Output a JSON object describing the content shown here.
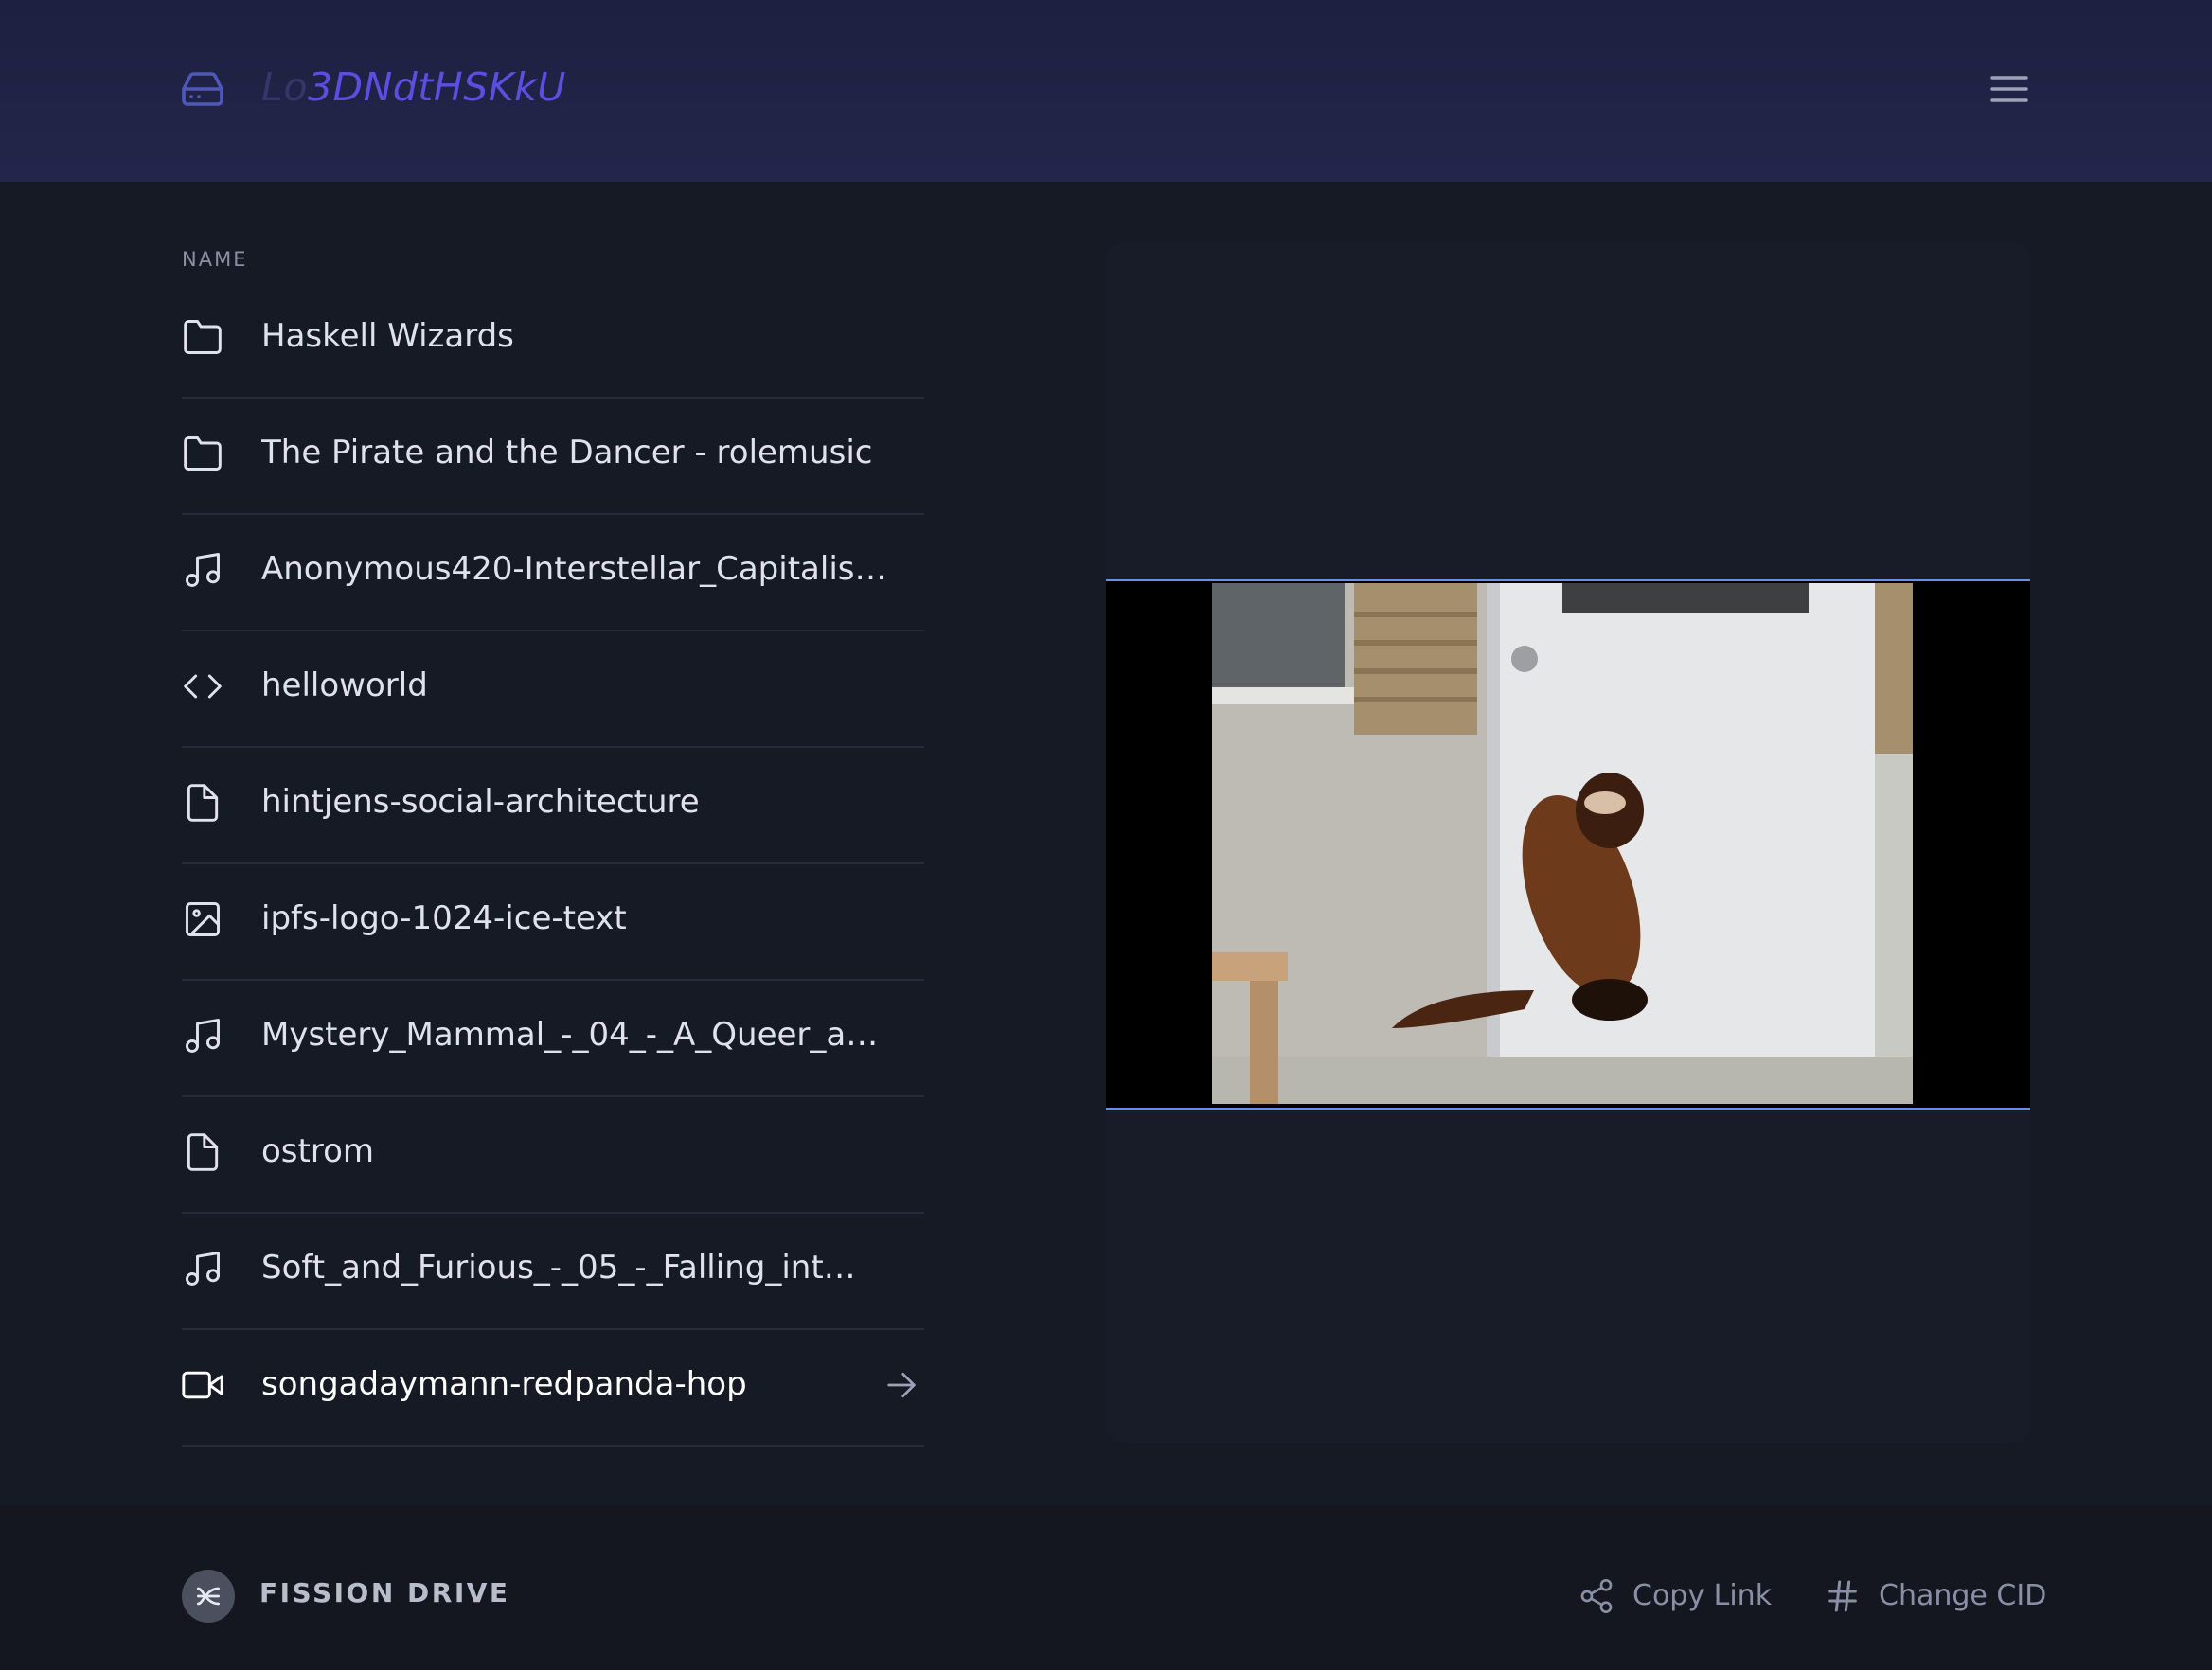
{
  "header": {
    "cid_faded": "Lo",
    "cid_main": "3DNdtHSKkU",
    "drive_icon": "hard-drive-icon",
    "menu_icon": "hamburger-menu-icon"
  },
  "list": {
    "column_header": "NAME",
    "items": [
      {
        "label": "Haskell Wizards",
        "icon": "folder-icon"
      },
      {
        "label": "The Pirate and the Dancer - rolemusic",
        "icon": "folder-icon"
      },
      {
        "label": "Anonymous420-Interstellar_Capitalism…",
        "icon": "music-icon"
      },
      {
        "label": "helloworld",
        "icon": "code-icon"
      },
      {
        "label": "hintjens-social-architecture",
        "icon": "file-icon"
      },
      {
        "label": "ipfs-logo-1024-ice-text",
        "icon": "image-icon"
      },
      {
        "label": "Mystery_Mammal_-_04_-_A_Queer_a…",
        "icon": "music-icon"
      },
      {
        "label": "ostrom",
        "icon": "file-icon"
      },
      {
        "label": "Soft_and_Furious_-_05_-_Falling_int…",
        "icon": "music-icon"
      },
      {
        "label": "songadaymann-redpanda-hop",
        "icon": "video-icon",
        "selected": true
      }
    ]
  },
  "footer": {
    "brand": "FISSION DRIVE",
    "copy_link": "Copy Link",
    "change_cid": "Change CID"
  },
  "colors": {
    "accent": "#5b4fe0",
    "background": "#161a25",
    "header": "#1f2244",
    "video_border": "#6d8de8"
  }
}
